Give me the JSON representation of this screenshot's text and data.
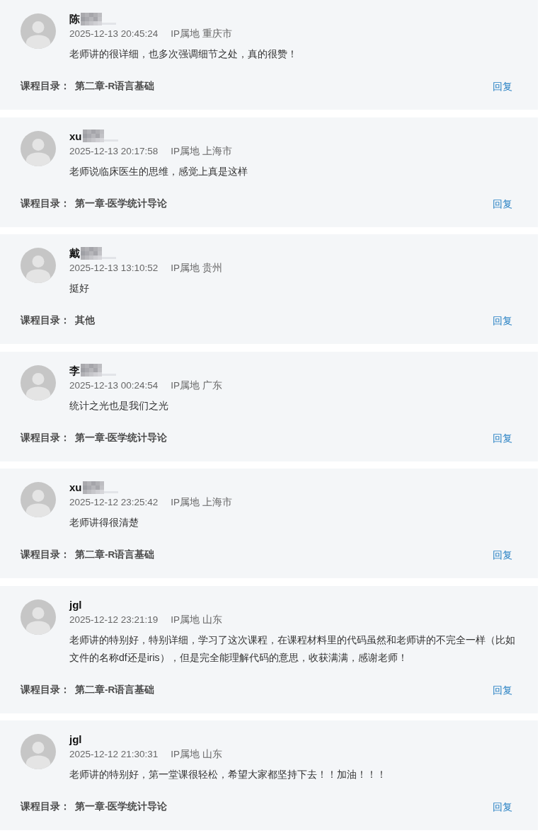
{
  "comments": [
    {
      "user": "陈",
      "redacted": true,
      "time": "2025-12-13 20:45:24",
      "location": "IP属地 重庆市",
      "text": "老师讲的很详细，也多次强调细节之处，真的很赞！",
      "catalog_label": "课程目录：",
      "chapter": "第二章-R语言基础",
      "reply": "回复"
    },
    {
      "user": "xu",
      "redacted": true,
      "time": "2025-12-13 20:17:58",
      "location": "IP属地 上海市",
      "text": "老师说临床医生的思维，感觉上真是这样",
      "catalog_label": "课程目录：",
      "chapter": "第一章-医学统计导论",
      "reply": "回复"
    },
    {
      "user": "戴",
      "redacted": true,
      "time": "2025-12-13 13:10:52",
      "location": "IP属地 贵州",
      "text": "挺好",
      "catalog_label": "课程目录：",
      "chapter": "其他",
      "reply": "回复"
    },
    {
      "user": "李",
      "redacted": true,
      "time": "2025-12-13 00:24:54",
      "location": "IP属地 广东",
      "text": "统计之光也是我们之光",
      "catalog_label": "课程目录：",
      "chapter": "第一章-医学统计导论",
      "reply": "回复"
    },
    {
      "user": "xu",
      "redacted": true,
      "time": "2025-12-12 23:25:42",
      "location": "IP属地 上海市",
      "text": "老师讲得很清楚",
      "catalog_label": "课程目录：",
      "chapter": "第二章-R语言基础",
      "reply": "回复"
    },
    {
      "user": "jgl",
      "redacted": false,
      "time": "2025-12-12 23:21:19",
      "location": "IP属地 山东",
      "text": "老师讲的特别好，特别详细，学习了这次课程，在课程材料里的代码虽然和老师讲的不完全一样（比如文件的名称df还是iris），但是完全能理解代码的意思，收获满满，感谢老师！",
      "catalog_label": "课程目录：",
      "chapter": "第二章-R语言基础",
      "reply": "回复"
    },
    {
      "user": "jgl",
      "redacted": false,
      "time": "2025-12-12 21:30:31",
      "location": "IP属地 山东",
      "text": "老师讲的特别好，第一堂课很轻松，希望大家都坚持下去！！加油！！！",
      "catalog_label": "课程目录：",
      "chapter": "第一章-医学统计导论",
      "reply": "回复"
    }
  ]
}
